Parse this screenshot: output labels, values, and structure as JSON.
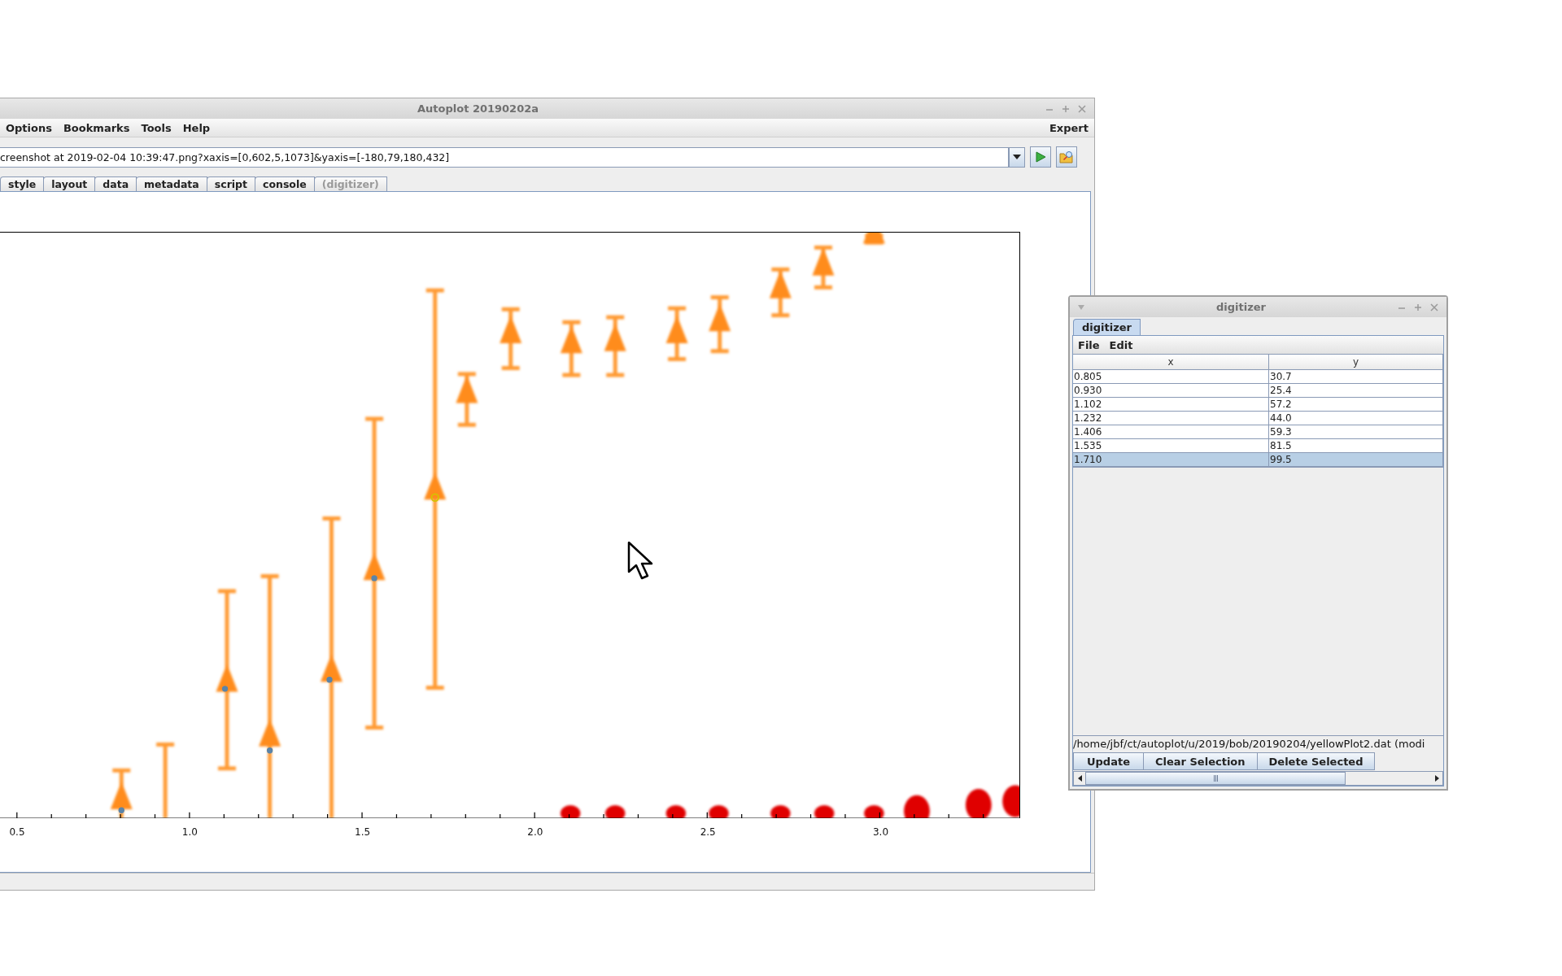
{
  "main_window": {
    "title": "Autoplot 20190202a",
    "menu": [
      "Options",
      "Bookmarks",
      "Tools",
      "Help"
    ],
    "menu_right": "Expert",
    "uri_field": {
      "value": "creenshot at 2019-02-04 10:39:47.png?xaxis=[0,602,5,1073]&yaxis=[-180,79,180,432]"
    },
    "tabs": [
      {
        "label": "style",
        "disabled": false
      },
      {
        "label": "layout",
        "disabled": false
      },
      {
        "label": "data",
        "disabled": false
      },
      {
        "label": "metadata",
        "disabled": false
      },
      {
        "label": "script",
        "disabled": false
      },
      {
        "label": "console",
        "disabled": false
      },
      {
        "label": "(digitizer)",
        "disabled": true
      }
    ],
    "x_axis": {
      "tick_labels": [
        "0.5",
        "1.0",
        "1.5",
        "2.0",
        "2.5",
        "3.0"
      ]
    }
  },
  "digitizer": {
    "title": "digitizer",
    "tabs": [
      {
        "label": "digitizer",
        "selected": true
      }
    ],
    "menu": [
      "File",
      "Edit"
    ],
    "table": {
      "columns": [
        "x",
        "y"
      ],
      "rows": [
        {
          "cells": [
            "0.805",
            "30.7"
          ],
          "selected": false
        },
        {
          "cells": [
            "0.930",
            "25.4"
          ],
          "selected": false
        },
        {
          "cells": [
            "1.102",
            "57.2"
          ],
          "selected": false
        },
        {
          "cells": [
            "1.232",
            "44.0"
          ],
          "selected": false
        },
        {
          "cells": [
            "1.406",
            "59.3"
          ],
          "selected": false
        },
        {
          "cells": [
            "1.535",
            "81.5"
          ],
          "selected": false
        },
        {
          "cells": [
            "1.710",
            "99.5"
          ],
          "selected": true
        }
      ]
    },
    "file_path": "/home/jbf/ct/autoplot/u/2019/bob/20190204/yellowPlot2.dat (modi",
    "buttons": [
      "Update",
      "Clear Selection",
      "Delete Selected"
    ]
  }
}
